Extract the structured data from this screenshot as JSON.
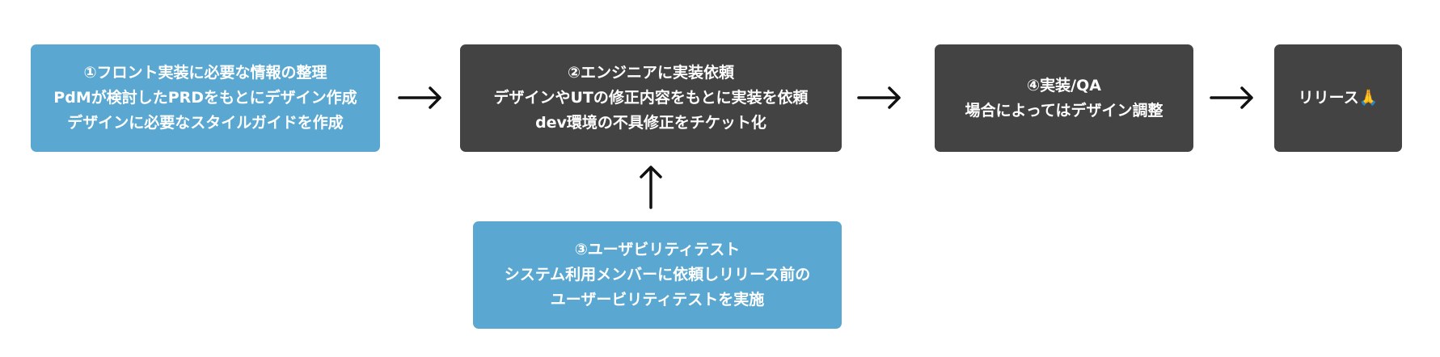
{
  "nodes": {
    "step1": {
      "lines": [
        "①フロント実装に必要な情報の整理",
        "PdMが検討したPRDをもとにデザイン作成",
        "デザインに必要なスタイルガイドを作成"
      ],
      "color": "#5aa8d1"
    },
    "step2": {
      "lines": [
        "②エンジニアに実装依頼",
        "デザインやUTの修正内容をもとに実装を依頼",
        "dev環境の不具修正をチケット化"
      ],
      "color": "#434343"
    },
    "step3": {
      "lines": [
        "③ユーザビリティテスト",
        "システム利用メンバーに依頼しリリース前の",
        "ユーザービリティテストを実施"
      ],
      "color": "#5aa8d1"
    },
    "step4": {
      "lines": [
        "④実装/QA",
        "場合によってはデザイン調整"
      ],
      "color": "#434343"
    },
    "step5": {
      "lines": [
        "リリース🙏"
      ],
      "color": "#434343"
    }
  },
  "edges": [
    {
      "from": "step1",
      "to": "step2"
    },
    {
      "from": "step2",
      "to": "step4"
    },
    {
      "from": "step4",
      "to": "step5"
    },
    {
      "from": "step3",
      "to": "step2"
    }
  ]
}
